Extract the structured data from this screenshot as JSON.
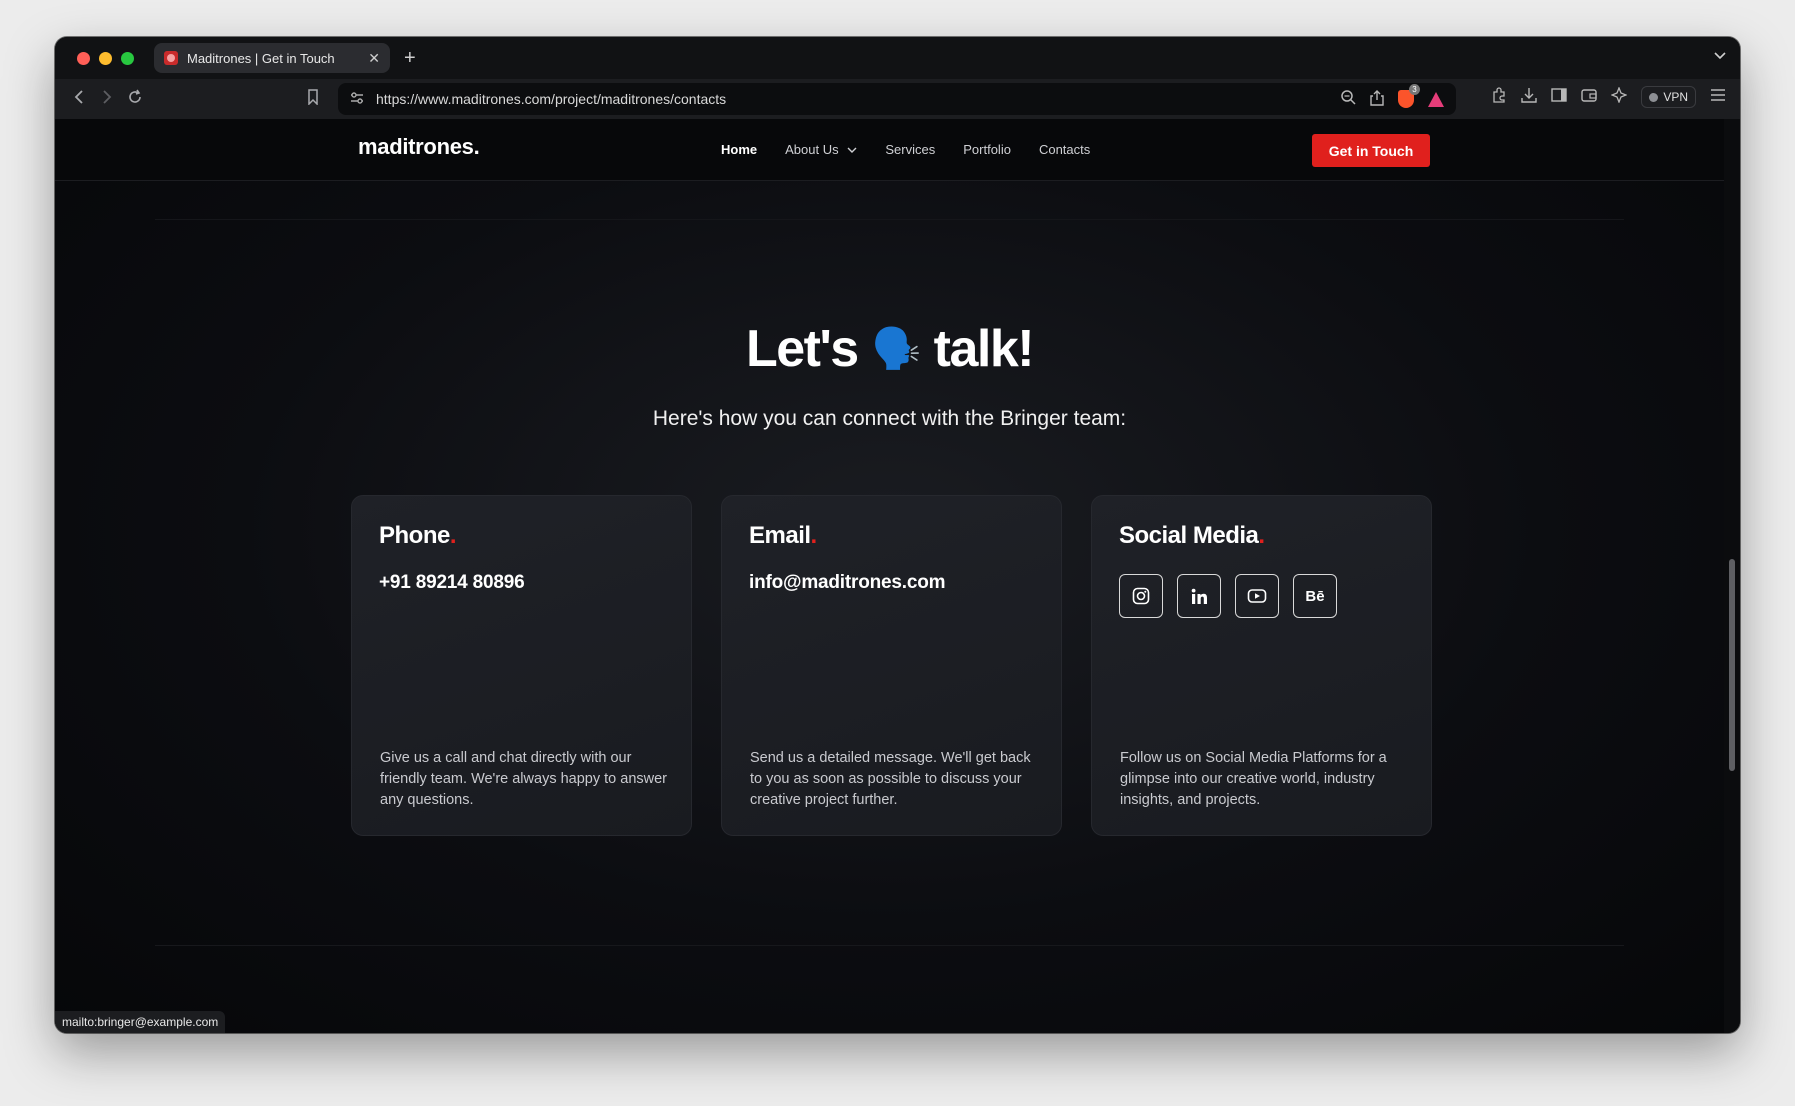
{
  "browser": {
    "tab_title": "Maditrones | Get in Touch",
    "tab_close": "✕",
    "new_tab": "+",
    "url": "https://www.maditrones.com/project/maditrones/contacts",
    "vpn_label": "VPN",
    "shields_count": "3",
    "status_text": "mailto:bringer@example.com"
  },
  "site": {
    "logo": "maditrones",
    "logo_dot": ".",
    "nav": {
      "home": "Home",
      "about": "About Us",
      "services": "Services",
      "portfolio": "Portfolio",
      "contacts": "Contacts"
    },
    "cta": "Get in Touch"
  },
  "hero": {
    "title_before": "Let's",
    "emoji": "🗣️",
    "title_after": "talk!",
    "subtitle": "Here's how you can connect with the Bringer team:"
  },
  "cards": {
    "phone": {
      "title": "Phone",
      "value": "+91 89214 80896",
      "desc": "Give us a call and chat directly with our friendly team. We're always happy to answer any questions."
    },
    "email": {
      "title": "Email",
      "value": "info@maditrones.com",
      "desc": "Send us a detailed message. We'll get back to you as soon as possible to discuss your creative project further."
    },
    "social": {
      "title": "Social Media",
      "behance_label": "Bē",
      "desc": "Follow us on Social Media Platforms for a glimpse into our creative world, industry insights, and projects."
    },
    "title_dot": "."
  },
  "colors": {
    "accent": "#e0201d",
    "page_bg": "#0c0d11",
    "card_bg": "#1f2127"
  }
}
